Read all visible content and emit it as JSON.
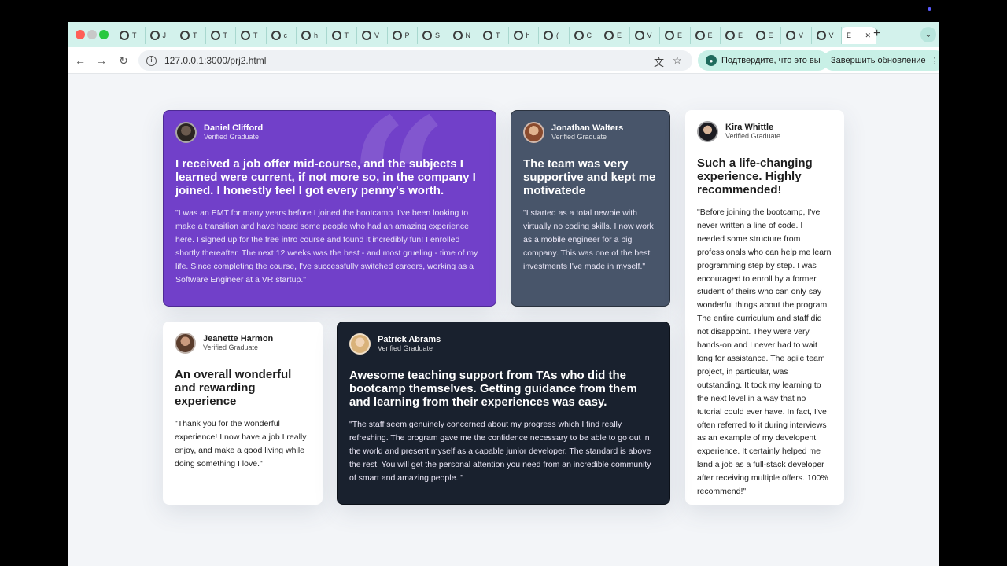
{
  "browser": {
    "tabs": [
      {
        "label": "T"
      },
      {
        "label": "J"
      },
      {
        "label": "T"
      },
      {
        "label": "T"
      },
      {
        "label": "T"
      },
      {
        "label": "c"
      },
      {
        "label": "h"
      },
      {
        "label": "T"
      },
      {
        "label": "V"
      },
      {
        "label": "P"
      },
      {
        "label": "S"
      },
      {
        "label": "N"
      },
      {
        "label": "T"
      },
      {
        "label": "h"
      },
      {
        "label": "("
      },
      {
        "label": "C"
      },
      {
        "label": "E"
      },
      {
        "label": "V"
      },
      {
        "label": "E"
      },
      {
        "label": "E"
      },
      {
        "label": "E"
      },
      {
        "label": "E"
      },
      {
        "label": "V"
      },
      {
        "label": "V"
      }
    ],
    "active_tab": {
      "label": "E",
      "close": "✕"
    },
    "new_tab": "+",
    "tab_menu": "⌄",
    "url": "127.0.0.1:3000/prj2.html",
    "confirm_button": "Подтвердите, что это вы",
    "update_button": "Завершить обновление",
    "menu_dots": "⋮",
    "colors": {
      "tabbar": "#d3f2ec",
      "pill": "#c8f0e6"
    }
  },
  "testimonials": [
    {
      "name": "Daniel Clifford",
      "role": "Verified Graduate",
      "headline": "I received a job offer mid-course, and the subjects I learned were current, if not more so, in the company I joined. I honestly feel I got every penny's worth.",
      "body": "\"I was an EMT for many years before I joined the bootcamp. I've been looking to make a transition and have heard some people who had an amazing experience here. I signed up for the free intro course and found it incredibly fun! I enrolled shortly thereafter. The next 12 weeks was the best - and most grueling - time of my life. Since completing the course, I've successfully switched careers, working as a Software Engineer at a VR startup.\"",
      "quote_mark": "“",
      "color": "#7140c9"
    },
    {
      "name": "Jonathan Walters",
      "role": "Verified Graduate",
      "headline": "The team was very supportive and kept me motivatede",
      "body": "\"I started as a total newbie with virtually no coding skills. I now work as a mobile engineer for a big company. This was one of the best investments I've made in myself.\"",
      "color": "#48556a"
    },
    {
      "name": "Kira Whittle",
      "role": "Verified Graduate",
      "headline": "Such a life-changing experience. Highly recommended!",
      "body": "\"Before joining the bootcamp, I've never written a line of code. I needed some structure from professionals who can help me learn programming step by step. I was encouraged to enroll by a former student of theirs who can only say wonderful things about the program. The entire curriculum and staff did not disappoint. They were very hands-on and I never had to wait long for assistance. The agile team project, in particular, was outstanding. It took my learning to the next level in a way that no tutorial could ever have. In fact, I've often referred to it during interviews as an example of my developent experience. It certainly helped me land a job as a full-stack developer after receiving multiple offers. 100% recommend!\"",
      "color": "#ffffff"
    },
    {
      "name": "Jeanette Harmon",
      "role": "Verified Graduate",
      "headline": "An overall wonderful and rewarding experience",
      "body": "\"Thank you for the wonderful experience! I now have a job I really enjoy, and make a good living while doing something I love.\"",
      "color": "#ffffff"
    },
    {
      "name": "Patrick Abrams",
      "role": "Verified Graduate",
      "headline": "Awesome teaching support from TAs who did the bootcamp themselves. Getting guidance from them and learning from their experiences was easy.",
      "body": "\"The staff seem genuinely concerned about my progress which I find really refreshing. The program gave me the confidence necessary to be able to go out in the world and present myself as a capable junior developer. The standard is above the rest. You will get the personal attention you need from an incredible community of smart and amazing people. \"",
      "color": "#19212e"
    }
  ]
}
